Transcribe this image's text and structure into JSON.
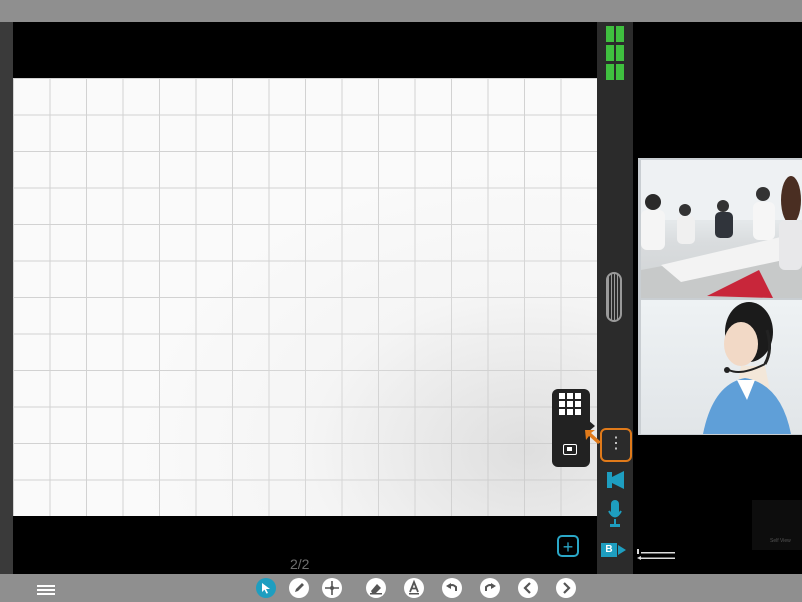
{
  "whiteboard": {
    "page_indicator": "2/2",
    "add_page_label": "+"
  },
  "side_panel": {
    "more_label": "⋮",
    "camera_badge": "B"
  },
  "video": {
    "self_label": "Self View"
  },
  "toolbar": {
    "tools": [
      "select",
      "pen",
      "move",
      "eraser",
      "text",
      "undo",
      "redo",
      "previous-page",
      "next-page"
    ]
  },
  "colors": {
    "accent_blue": "#1e9ec0",
    "layout_green": "#3fbf3f",
    "highlight_orange": "#e07a1a",
    "toolbar_gray": "#8f8f8f"
  }
}
